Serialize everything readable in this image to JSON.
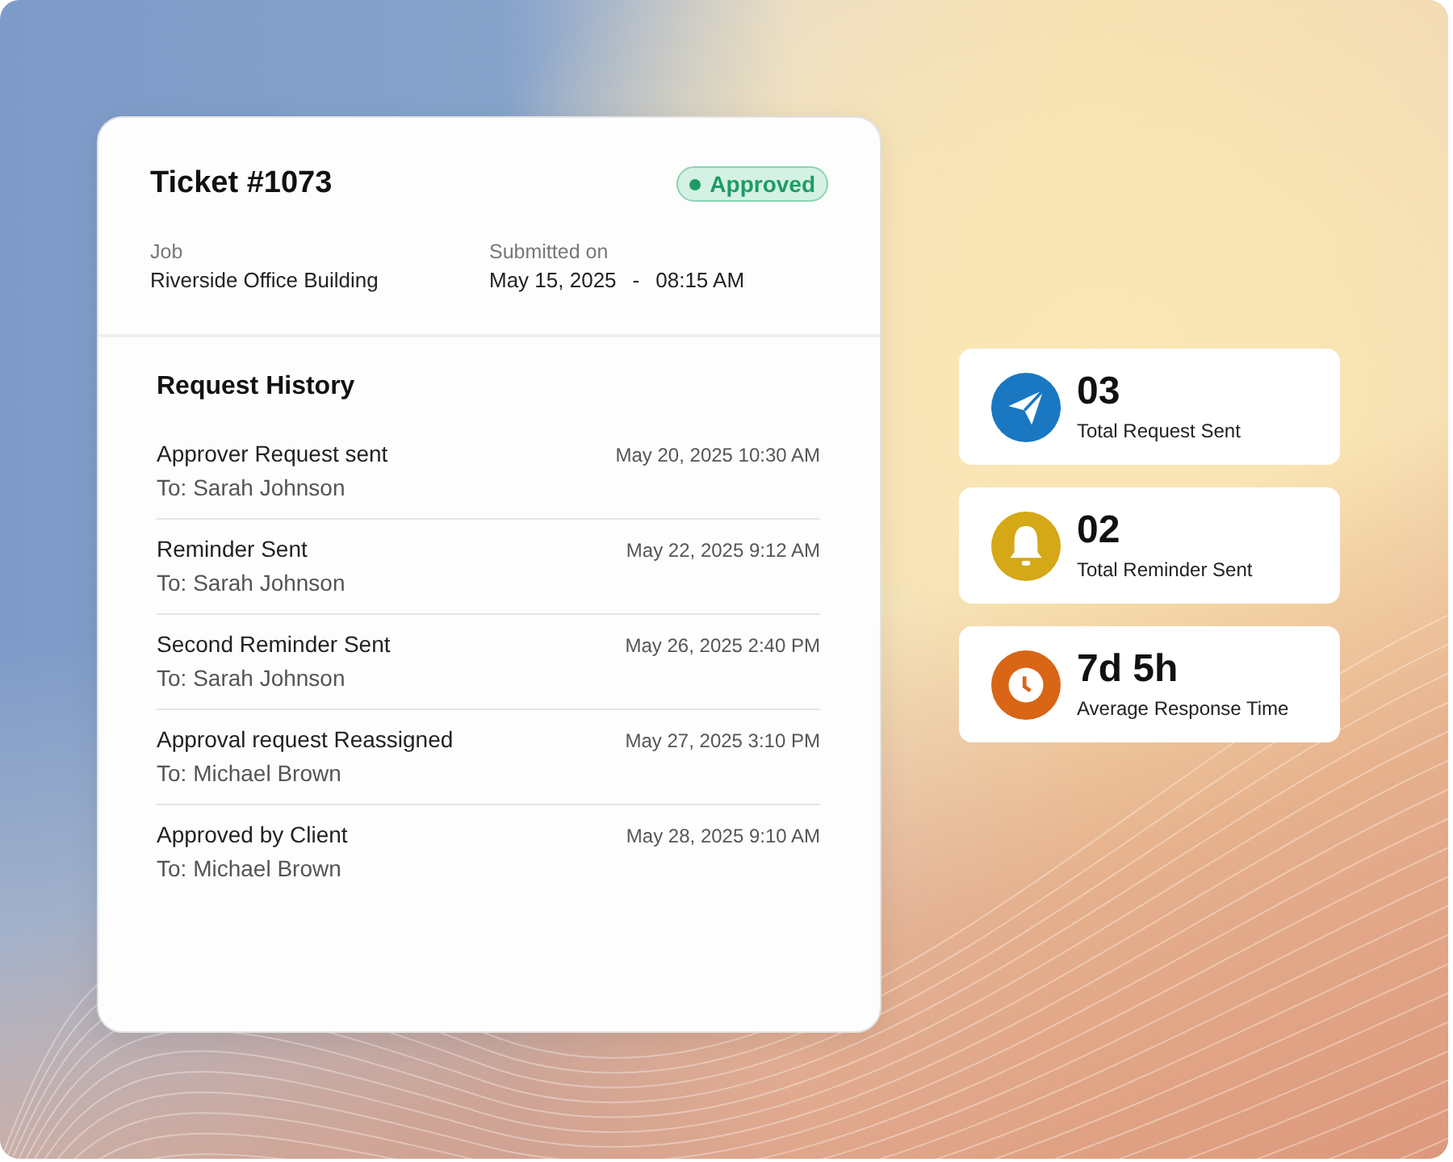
{
  "ticket": {
    "title": "Ticket #1073",
    "status": "Approved",
    "job_label": "Job",
    "job": "Riverside Office Building",
    "submitted_label": "Submitted on",
    "submitted_date": "May 15, 2025",
    "separator": "-",
    "submitted_time": "08:15 AM"
  },
  "history": {
    "title": "Request History",
    "items": [
      {
        "title": "Approver Request sent",
        "recipient": "To: Sarah Johnson",
        "time": "May 20, 2025 10:30 AM"
      },
      {
        "title": "Reminder Sent",
        "recipient": "To: Sarah Johnson",
        "time": "May 22, 2025 9:12 AM"
      },
      {
        "title": "Second Reminder Sent",
        "recipient": "To: Sarah Johnson",
        "time": "May 26, 2025 2:40 PM"
      },
      {
        "title": "Approval request Reassigned",
        "recipient": "To: Michael Brown",
        "time": "May 27, 2025 3:10 PM"
      },
      {
        "title": "Approved by Client",
        "recipient": "To: Michael Brown",
        "time": "May 28, 2025 9:10 AM"
      }
    ]
  },
  "stats": [
    {
      "value": "03",
      "label": "Total Request Sent",
      "color": "#1a78c2"
    },
    {
      "value": "02",
      "label": "Total Reminder Sent",
      "color": "#d4a816"
    },
    {
      "value": "7d 5h",
      "label": "Average Response Time",
      "color": "#d96516"
    }
  ]
}
